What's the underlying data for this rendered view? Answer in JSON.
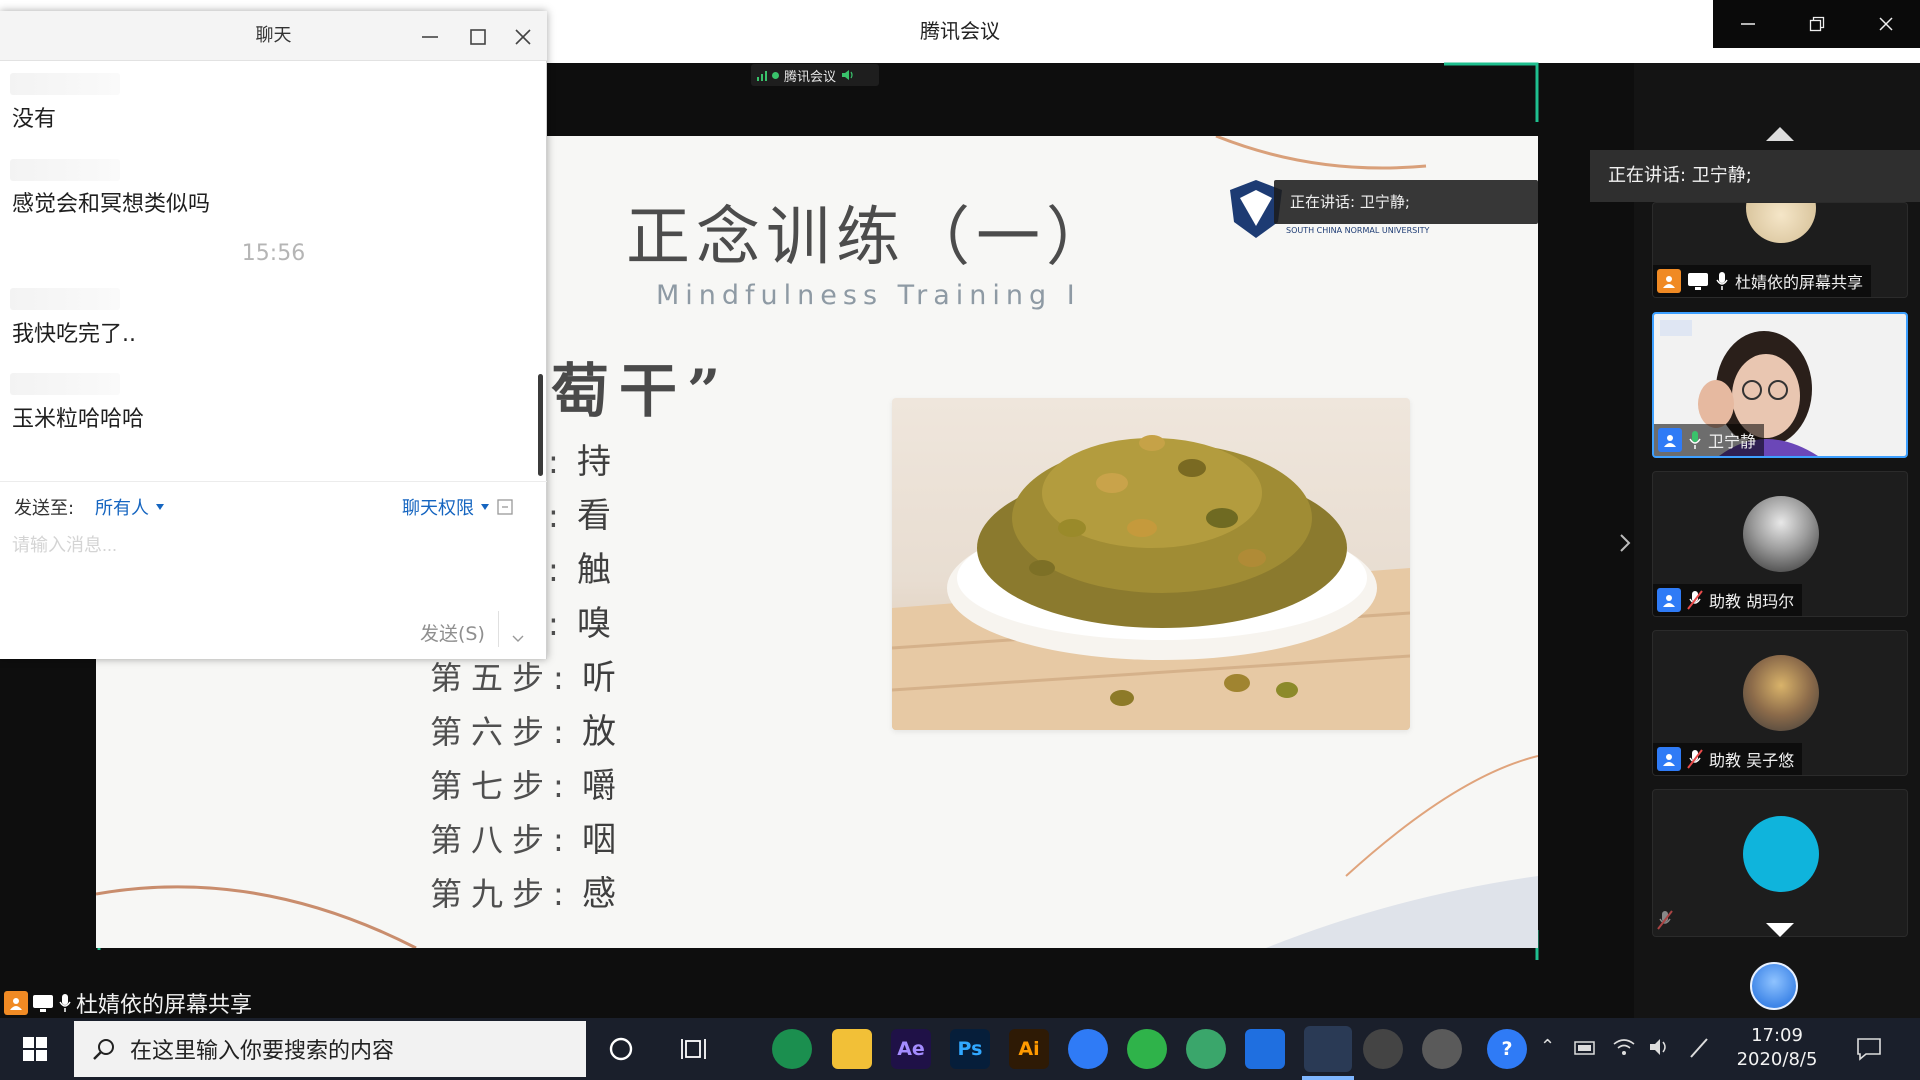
{
  "window": {
    "title": "腾讯会议",
    "status_pill_label": "腾讯会议"
  },
  "slide": {
    "title": "正念训练（一）",
    "subtitle": "Mindfulness Training I",
    "raisin_heading": "萄干”",
    "steps": [
      {
        "num": "",
        "verb": "持"
      },
      {
        "num": "",
        "verb": "看"
      },
      {
        "num": "",
        "verb": "触"
      },
      {
        "num": "",
        "verb": "嗅"
      },
      {
        "num": "第五步",
        "verb": "听"
      },
      {
        "num": "第六步",
        "verb": "放"
      },
      {
        "num": "第七步",
        "verb": "嚼"
      },
      {
        "num": "第八步",
        "verb": "咽"
      },
      {
        "num": "第九步",
        "verb": "感"
      }
    ],
    "logo_text": "SOUTH CHINA NORMAL UNIVERSITY",
    "speaking_overlay": "正在讲话: 卫宁静;"
  },
  "panel": {
    "speaking": "正在讲话: 卫宁静;",
    "tiles": [
      {
        "name": "杜婧依的屏幕共享"
      },
      {
        "name": "卫宁静"
      },
      {
        "name": "助教 胡玛尔"
      },
      {
        "name": "助教 吴子悠"
      },
      {
        "name": ""
      }
    ]
  },
  "chat": {
    "title": "聊天",
    "messages": [
      {
        "text": "没有"
      },
      {
        "text": "感觉会和冥想类似吗"
      },
      {
        "text": "我快吃完了.."
      },
      {
        "text": "玉米粒哈哈哈"
      }
    ],
    "time": "15:56",
    "send_to_label": "发送至:",
    "send_to_value": "所有人",
    "permission_label": "聊天权限",
    "input_placeholder": "请输入消息...",
    "send_button": "发送(S)"
  },
  "share_strip": {
    "label": "杜婧依的屏幕共享"
  },
  "taskbar": {
    "search_placeholder": "在这里输入你要搜索的内容",
    "apps": [
      "Ae",
      "Ps",
      "Ai"
    ],
    "time": "17:09",
    "date": "2020/8/5"
  },
  "colors": {
    "accent_blue": "#2f7bf6",
    "share_orange": "#f08a24",
    "meeting_green": "#39c36b",
    "chat_link": "#1565c0"
  }
}
